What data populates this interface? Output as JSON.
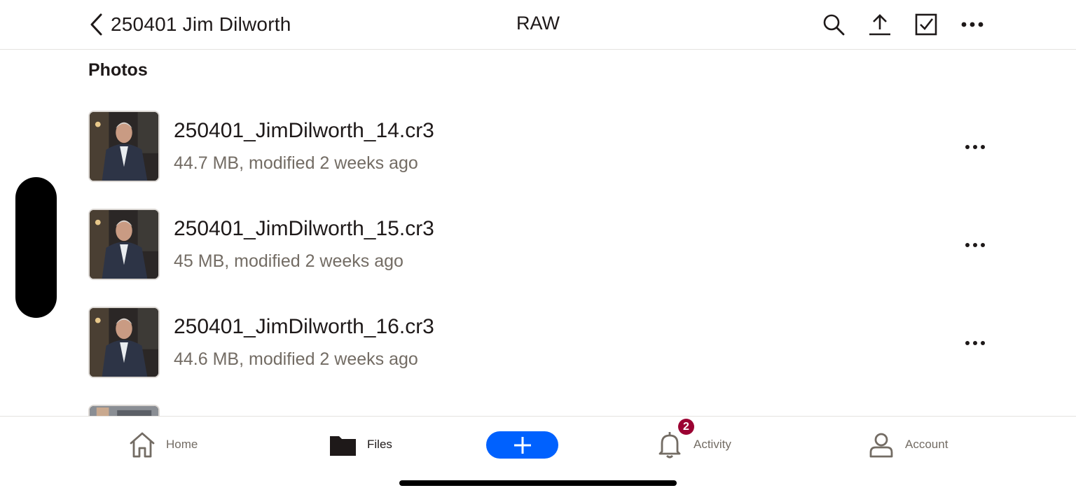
{
  "header": {
    "back_label": "250401 Jim Dilworth",
    "title": "RAW",
    "tools": [
      {
        "name": "search-icon"
      },
      {
        "name": "upload-icon"
      },
      {
        "name": "select-checkbox-icon"
      },
      {
        "name": "more-icon"
      }
    ]
  },
  "section_title": "Photos",
  "files": [
    {
      "name": "250401_JimDilworth_14.cr3",
      "meta": "44.7 MB, modified 2 weeks ago"
    },
    {
      "name": "250401_JimDilworth_15.cr3",
      "meta": "45 MB, modified 2 weeks ago"
    },
    {
      "name": "250401_JimDilworth_16.cr3",
      "meta": "44.6 MB, modified 2 weeks ago"
    }
  ],
  "tabs": [
    {
      "label": "Home",
      "icon": "home-icon"
    },
    {
      "label": "Files",
      "icon": "folder-icon",
      "active": true
    },
    {
      "label": "Activity",
      "icon": "bell-icon",
      "badge": "2"
    },
    {
      "label": "Account",
      "icon": "person-icon"
    }
  ],
  "colors": {
    "accent": "#0061fe",
    "badge": "#9b0032",
    "text": "#1e1919",
    "secondary": "#736c64"
  }
}
